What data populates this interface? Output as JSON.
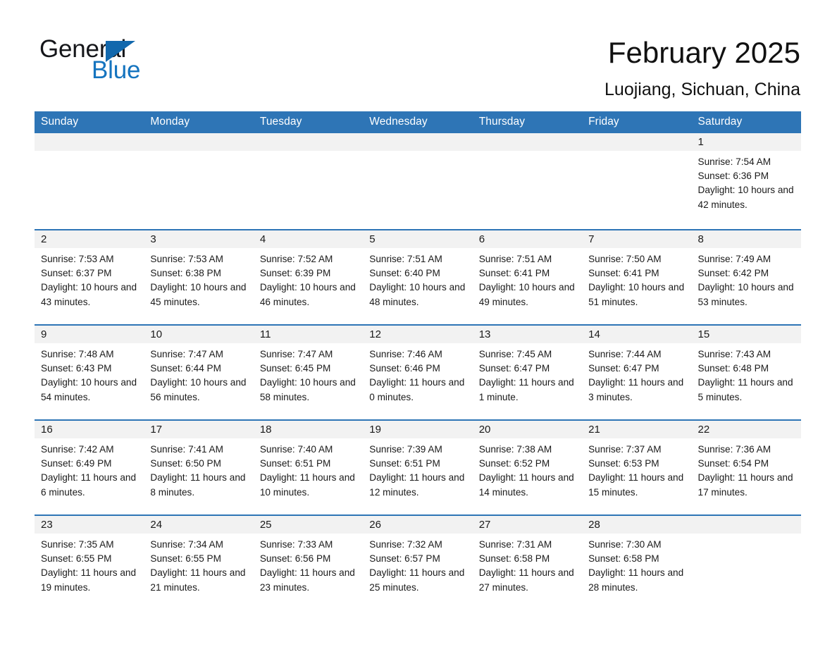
{
  "brand": {
    "name_part1": "General",
    "name_part2": "Blue",
    "accent_color": "#1268ad",
    "header_color": "#2e75b6"
  },
  "header": {
    "title": "February 2025",
    "location": "Luojiang, Sichuan, China"
  },
  "weekday_headers": [
    "Sunday",
    "Monday",
    "Tuesday",
    "Wednesday",
    "Thursday",
    "Friday",
    "Saturday"
  ],
  "weeks": [
    [
      {
        "day": "",
        "empty": true
      },
      {
        "day": "",
        "empty": true
      },
      {
        "day": "",
        "empty": true
      },
      {
        "day": "",
        "empty": true
      },
      {
        "day": "",
        "empty": true
      },
      {
        "day": "",
        "empty": true
      },
      {
        "day": "1",
        "sunrise": "Sunrise: 7:54 AM",
        "sunset": "Sunset: 6:36 PM",
        "daylight": "Daylight: 10 hours and 42 minutes."
      }
    ],
    [
      {
        "day": "2",
        "sunrise": "Sunrise: 7:53 AM",
        "sunset": "Sunset: 6:37 PM",
        "daylight": "Daylight: 10 hours and 43 minutes."
      },
      {
        "day": "3",
        "sunrise": "Sunrise: 7:53 AM",
        "sunset": "Sunset: 6:38 PM",
        "daylight": "Daylight: 10 hours and 45 minutes."
      },
      {
        "day": "4",
        "sunrise": "Sunrise: 7:52 AM",
        "sunset": "Sunset: 6:39 PM",
        "daylight": "Daylight: 10 hours and 46 minutes."
      },
      {
        "day": "5",
        "sunrise": "Sunrise: 7:51 AM",
        "sunset": "Sunset: 6:40 PM",
        "daylight": "Daylight: 10 hours and 48 minutes."
      },
      {
        "day": "6",
        "sunrise": "Sunrise: 7:51 AM",
        "sunset": "Sunset: 6:41 PM",
        "daylight": "Daylight: 10 hours and 49 minutes."
      },
      {
        "day": "7",
        "sunrise": "Sunrise: 7:50 AM",
        "sunset": "Sunset: 6:41 PM",
        "daylight": "Daylight: 10 hours and 51 minutes."
      },
      {
        "day": "8",
        "sunrise": "Sunrise: 7:49 AM",
        "sunset": "Sunset: 6:42 PM",
        "daylight": "Daylight: 10 hours and 53 minutes."
      }
    ],
    [
      {
        "day": "9",
        "sunrise": "Sunrise: 7:48 AM",
        "sunset": "Sunset: 6:43 PM",
        "daylight": "Daylight: 10 hours and 54 minutes."
      },
      {
        "day": "10",
        "sunrise": "Sunrise: 7:47 AM",
        "sunset": "Sunset: 6:44 PM",
        "daylight": "Daylight: 10 hours and 56 minutes."
      },
      {
        "day": "11",
        "sunrise": "Sunrise: 7:47 AM",
        "sunset": "Sunset: 6:45 PM",
        "daylight": "Daylight: 10 hours and 58 minutes."
      },
      {
        "day": "12",
        "sunrise": "Sunrise: 7:46 AM",
        "sunset": "Sunset: 6:46 PM",
        "daylight": "Daylight: 11 hours and 0 minutes."
      },
      {
        "day": "13",
        "sunrise": "Sunrise: 7:45 AM",
        "sunset": "Sunset: 6:47 PM",
        "daylight": "Daylight: 11 hours and 1 minute."
      },
      {
        "day": "14",
        "sunrise": "Sunrise: 7:44 AM",
        "sunset": "Sunset: 6:47 PM",
        "daylight": "Daylight: 11 hours and 3 minutes."
      },
      {
        "day": "15",
        "sunrise": "Sunrise: 7:43 AM",
        "sunset": "Sunset: 6:48 PM",
        "daylight": "Daylight: 11 hours and 5 minutes."
      }
    ],
    [
      {
        "day": "16",
        "sunrise": "Sunrise: 7:42 AM",
        "sunset": "Sunset: 6:49 PM",
        "daylight": "Daylight: 11 hours and 6 minutes."
      },
      {
        "day": "17",
        "sunrise": "Sunrise: 7:41 AM",
        "sunset": "Sunset: 6:50 PM",
        "daylight": "Daylight: 11 hours and 8 minutes."
      },
      {
        "day": "18",
        "sunrise": "Sunrise: 7:40 AM",
        "sunset": "Sunset: 6:51 PM",
        "daylight": "Daylight: 11 hours and 10 minutes."
      },
      {
        "day": "19",
        "sunrise": "Sunrise: 7:39 AM",
        "sunset": "Sunset: 6:51 PM",
        "daylight": "Daylight: 11 hours and 12 minutes."
      },
      {
        "day": "20",
        "sunrise": "Sunrise: 7:38 AM",
        "sunset": "Sunset: 6:52 PM",
        "daylight": "Daylight: 11 hours and 14 minutes."
      },
      {
        "day": "21",
        "sunrise": "Sunrise: 7:37 AM",
        "sunset": "Sunset: 6:53 PM",
        "daylight": "Daylight: 11 hours and 15 minutes."
      },
      {
        "day": "22",
        "sunrise": "Sunrise: 7:36 AM",
        "sunset": "Sunset: 6:54 PM",
        "daylight": "Daylight: 11 hours and 17 minutes."
      }
    ],
    [
      {
        "day": "23",
        "sunrise": "Sunrise: 7:35 AM",
        "sunset": "Sunset: 6:55 PM",
        "daylight": "Daylight: 11 hours and 19 minutes."
      },
      {
        "day": "24",
        "sunrise": "Sunrise: 7:34 AM",
        "sunset": "Sunset: 6:55 PM",
        "daylight": "Daylight: 11 hours and 21 minutes."
      },
      {
        "day": "25",
        "sunrise": "Sunrise: 7:33 AM",
        "sunset": "Sunset: 6:56 PM",
        "daylight": "Daylight: 11 hours and 23 minutes."
      },
      {
        "day": "26",
        "sunrise": "Sunrise: 7:32 AM",
        "sunset": "Sunset: 6:57 PM",
        "daylight": "Daylight: 11 hours and 25 minutes."
      },
      {
        "day": "27",
        "sunrise": "Sunrise: 7:31 AM",
        "sunset": "Sunset: 6:58 PM",
        "daylight": "Daylight: 11 hours and 27 minutes."
      },
      {
        "day": "28",
        "sunrise": "Sunrise: 7:30 AM",
        "sunset": "Sunset: 6:58 PM",
        "daylight": "Daylight: 11 hours and 28 minutes."
      },
      {
        "day": "",
        "empty": true
      }
    ]
  ]
}
